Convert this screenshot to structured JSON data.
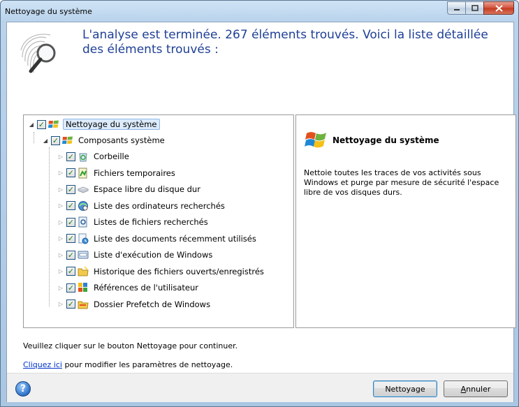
{
  "window": {
    "title": "Nettoyage du système"
  },
  "header": {
    "heading": "L'analyse est terminée. 267 éléments trouvés. Voici la liste détaillée des éléments trouvés :"
  },
  "tree": {
    "root": {
      "label": "Nettoyage du système",
      "checked": true,
      "icon": "windows-flag-icon"
    },
    "group": {
      "label": "Composants système",
      "checked": true,
      "icon": "windows-flag-icon"
    },
    "items": [
      {
        "label": "Corbeille",
        "icon": "recycle-bin-icon",
        "checked": true
      },
      {
        "label": "Fichiers temporaires",
        "icon": "temp-files-icon",
        "checked": true
      },
      {
        "label": "Espace libre du disque dur",
        "icon": "hard-disk-icon",
        "checked": true
      },
      {
        "label": "Liste des ordinateurs recherchés",
        "icon": "computer-search-icon",
        "checked": true
      },
      {
        "label": "Listes de fichiers recherchés",
        "icon": "file-search-icon",
        "checked": true
      },
      {
        "label": "Liste des documents récemment utilisés",
        "icon": "recent-documents-icon",
        "checked": true
      },
      {
        "label": "Liste d'exécution de Windows",
        "icon": "run-list-icon",
        "checked": true
      },
      {
        "label": "Historique des fichiers ouverts/enregistrés",
        "icon": "folder-history-icon",
        "checked": true
      },
      {
        "label": "Références de l'utilisateur",
        "icon": "user-references-icon",
        "checked": true
      },
      {
        "label": "Dossier Prefetch de Windows",
        "icon": "prefetch-folder-icon",
        "checked": true
      }
    ]
  },
  "info": {
    "title": "Nettoyage du système",
    "text": "Nettoie toutes les traces de vos activités sous Windows et purge par mesure de sécurité l'espace libre de vos disques durs."
  },
  "messages": {
    "instruction": "Veuillez cliquer sur le bouton Nettoyage pour continuer.",
    "link_text": "Cliquez ici",
    "link_suffix": " pour modifier les paramètres de nettoyage."
  },
  "buttons": {
    "clean": "Nettoyage",
    "cancel_prefix": "",
    "cancel_accel": "A",
    "cancel_rest": "nnuler"
  },
  "colors": {
    "heading": "#1e3f96",
    "link": "#0033cc",
    "selection": "#dcebfc"
  }
}
